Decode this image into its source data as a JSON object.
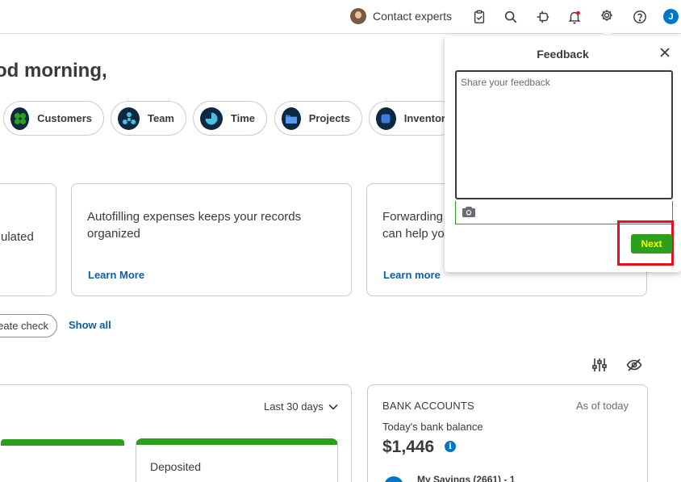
{
  "topbar": {
    "contact_experts": "Contact experts",
    "user_initial": "J",
    "icons": [
      "clipboard-check-icon",
      "search-icon",
      "plug-icon",
      "bell-icon",
      "gear-icon",
      "help-icon"
    ]
  },
  "greeting": "od morning,",
  "shortcuts": [
    "Customers",
    "Team",
    "Time",
    "Projects",
    "Inventor"
  ],
  "cards": {
    "card1_text": "ulated",
    "card2_text": "Autofilling expenses keeps your records organized",
    "card2_link": "Learn More",
    "card3_text": "Forwarding can help yo",
    "card3_link": "Learn more"
  },
  "actions": {
    "create_check": "eate check",
    "show_all": "Show all"
  },
  "widgets": {
    "period_label": "Last 30 days",
    "deposited_label": "Deposited",
    "bank_title": "BANK ACCOUNTS",
    "as_of": "As of today",
    "bank_balance_label": "Today's bank balance",
    "bank_balance": "$1,446",
    "account_name": "My Savings (2661) - 1"
  },
  "feedback": {
    "title": "Feedback",
    "placeholder": "Share your feedback",
    "next_label": "Next"
  },
  "colors": {
    "brand_green": "#2ca01c",
    "link_blue": "#0d5ea8",
    "highlight_red": "#e8101e",
    "nav_dark": "#0d2841"
  }
}
